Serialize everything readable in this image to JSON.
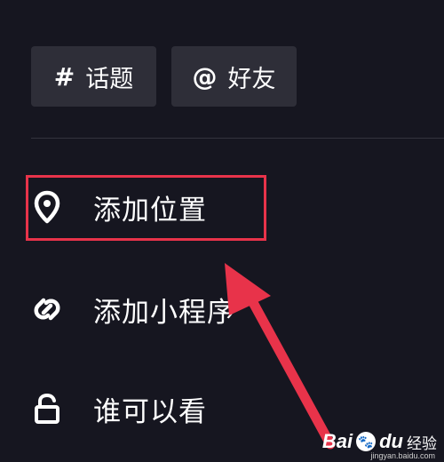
{
  "chips": {
    "topic": {
      "symbol": "#",
      "label": "话题"
    },
    "friend": {
      "symbol": "@",
      "label": "好友"
    }
  },
  "menu": {
    "items": [
      {
        "label": "添加位置",
        "icon": "location-pin-icon"
      },
      {
        "label": "添加小程序",
        "icon": "mini-program-icon"
      },
      {
        "label": "谁可以看",
        "icon": "unlock-icon"
      }
    ]
  },
  "annotation": {
    "highlight_color": "#e8334a"
  },
  "watermark": {
    "brand": "Bai",
    "brand2": "du",
    "suffix": "经验",
    "url": "jingyan.baidu.com"
  }
}
